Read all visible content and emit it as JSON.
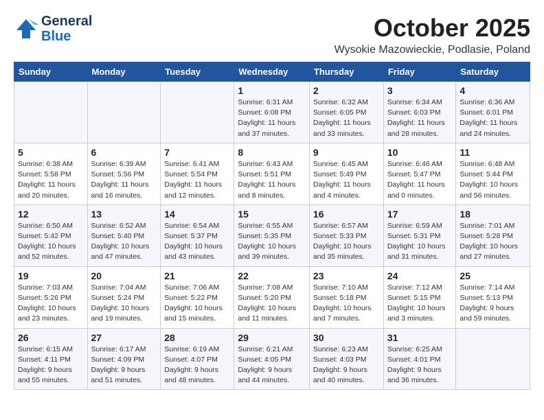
{
  "header": {
    "logo_general": "General",
    "logo_blue": "Blue",
    "month": "October 2025",
    "location": "Wysokie Mazowieckie, Podlasie, Poland"
  },
  "weekdays": [
    "Sunday",
    "Monday",
    "Tuesday",
    "Wednesday",
    "Thursday",
    "Friday",
    "Saturday"
  ],
  "weeks": [
    [
      {
        "day": "",
        "info": ""
      },
      {
        "day": "",
        "info": ""
      },
      {
        "day": "",
        "info": ""
      },
      {
        "day": "1",
        "info": "Sunrise: 6:31 AM\nSunset: 6:08 PM\nDaylight: 11 hours\nand 37 minutes."
      },
      {
        "day": "2",
        "info": "Sunrise: 6:32 AM\nSunset: 6:05 PM\nDaylight: 11 hours\nand 33 minutes."
      },
      {
        "day": "3",
        "info": "Sunrise: 6:34 AM\nSunset: 6:03 PM\nDaylight: 11 hours\nand 28 minutes."
      },
      {
        "day": "4",
        "info": "Sunrise: 6:36 AM\nSunset: 6:01 PM\nDaylight: 11 hours\nand 24 minutes."
      }
    ],
    [
      {
        "day": "5",
        "info": "Sunrise: 6:38 AM\nSunset: 5:58 PM\nDaylight: 11 hours\nand 20 minutes."
      },
      {
        "day": "6",
        "info": "Sunrise: 6:39 AM\nSunset: 5:56 PM\nDaylight: 11 hours\nand 16 minutes."
      },
      {
        "day": "7",
        "info": "Sunrise: 6:41 AM\nSunset: 5:54 PM\nDaylight: 11 hours\nand 12 minutes."
      },
      {
        "day": "8",
        "info": "Sunrise: 6:43 AM\nSunset: 5:51 PM\nDaylight: 11 hours\nand 8 minutes."
      },
      {
        "day": "9",
        "info": "Sunrise: 6:45 AM\nSunset: 5:49 PM\nDaylight: 11 hours\nand 4 minutes."
      },
      {
        "day": "10",
        "info": "Sunrise: 6:46 AM\nSunset: 5:47 PM\nDaylight: 11 hours\nand 0 minutes."
      },
      {
        "day": "11",
        "info": "Sunrise: 6:48 AM\nSunset: 5:44 PM\nDaylight: 10 hours\nand 56 minutes."
      }
    ],
    [
      {
        "day": "12",
        "info": "Sunrise: 6:50 AM\nSunset: 5:42 PM\nDaylight: 10 hours\nand 52 minutes."
      },
      {
        "day": "13",
        "info": "Sunrise: 6:52 AM\nSunset: 5:40 PM\nDaylight: 10 hours\nand 47 minutes."
      },
      {
        "day": "14",
        "info": "Sunrise: 6:54 AM\nSunset: 5:37 PM\nDaylight: 10 hours\nand 43 minutes."
      },
      {
        "day": "15",
        "info": "Sunrise: 6:55 AM\nSunset: 5:35 PM\nDaylight: 10 hours\nand 39 minutes."
      },
      {
        "day": "16",
        "info": "Sunrise: 6:57 AM\nSunset: 5:33 PM\nDaylight: 10 hours\nand 35 minutes."
      },
      {
        "day": "17",
        "info": "Sunrise: 6:59 AM\nSunset: 5:31 PM\nDaylight: 10 hours\nand 31 minutes."
      },
      {
        "day": "18",
        "info": "Sunrise: 7:01 AM\nSunset: 5:28 PM\nDaylight: 10 hours\nand 27 minutes."
      }
    ],
    [
      {
        "day": "19",
        "info": "Sunrise: 7:03 AM\nSunset: 5:26 PM\nDaylight: 10 hours\nand 23 minutes."
      },
      {
        "day": "20",
        "info": "Sunrise: 7:04 AM\nSunset: 5:24 PM\nDaylight: 10 hours\nand 19 minutes."
      },
      {
        "day": "21",
        "info": "Sunrise: 7:06 AM\nSunset: 5:22 PM\nDaylight: 10 hours\nand 15 minutes."
      },
      {
        "day": "22",
        "info": "Sunrise: 7:08 AM\nSunset: 5:20 PM\nDaylight: 10 hours\nand 11 minutes."
      },
      {
        "day": "23",
        "info": "Sunrise: 7:10 AM\nSunset: 5:18 PM\nDaylight: 10 hours\nand 7 minutes."
      },
      {
        "day": "24",
        "info": "Sunrise: 7:12 AM\nSunset: 5:15 PM\nDaylight: 10 hours\nand 3 minutes."
      },
      {
        "day": "25",
        "info": "Sunrise: 7:14 AM\nSunset: 5:13 PM\nDaylight: 9 hours\nand 59 minutes."
      }
    ],
    [
      {
        "day": "26",
        "info": "Sunrise: 6:15 AM\nSunset: 4:11 PM\nDaylight: 9 hours\nand 55 minutes."
      },
      {
        "day": "27",
        "info": "Sunrise: 6:17 AM\nSunset: 4:09 PM\nDaylight: 9 hours\nand 51 minutes."
      },
      {
        "day": "28",
        "info": "Sunrise: 6:19 AM\nSunset: 4:07 PM\nDaylight: 9 hours\nand 48 minutes."
      },
      {
        "day": "29",
        "info": "Sunrise: 6:21 AM\nSunset: 4:05 PM\nDaylight: 9 hours\nand 44 minutes."
      },
      {
        "day": "30",
        "info": "Sunrise: 6:23 AM\nSunset: 4:03 PM\nDaylight: 9 hours\nand 40 minutes."
      },
      {
        "day": "31",
        "info": "Sunrise: 6:25 AM\nSunset: 4:01 PM\nDaylight: 9 hours\nand 36 minutes."
      },
      {
        "day": "",
        "info": ""
      }
    ]
  ]
}
